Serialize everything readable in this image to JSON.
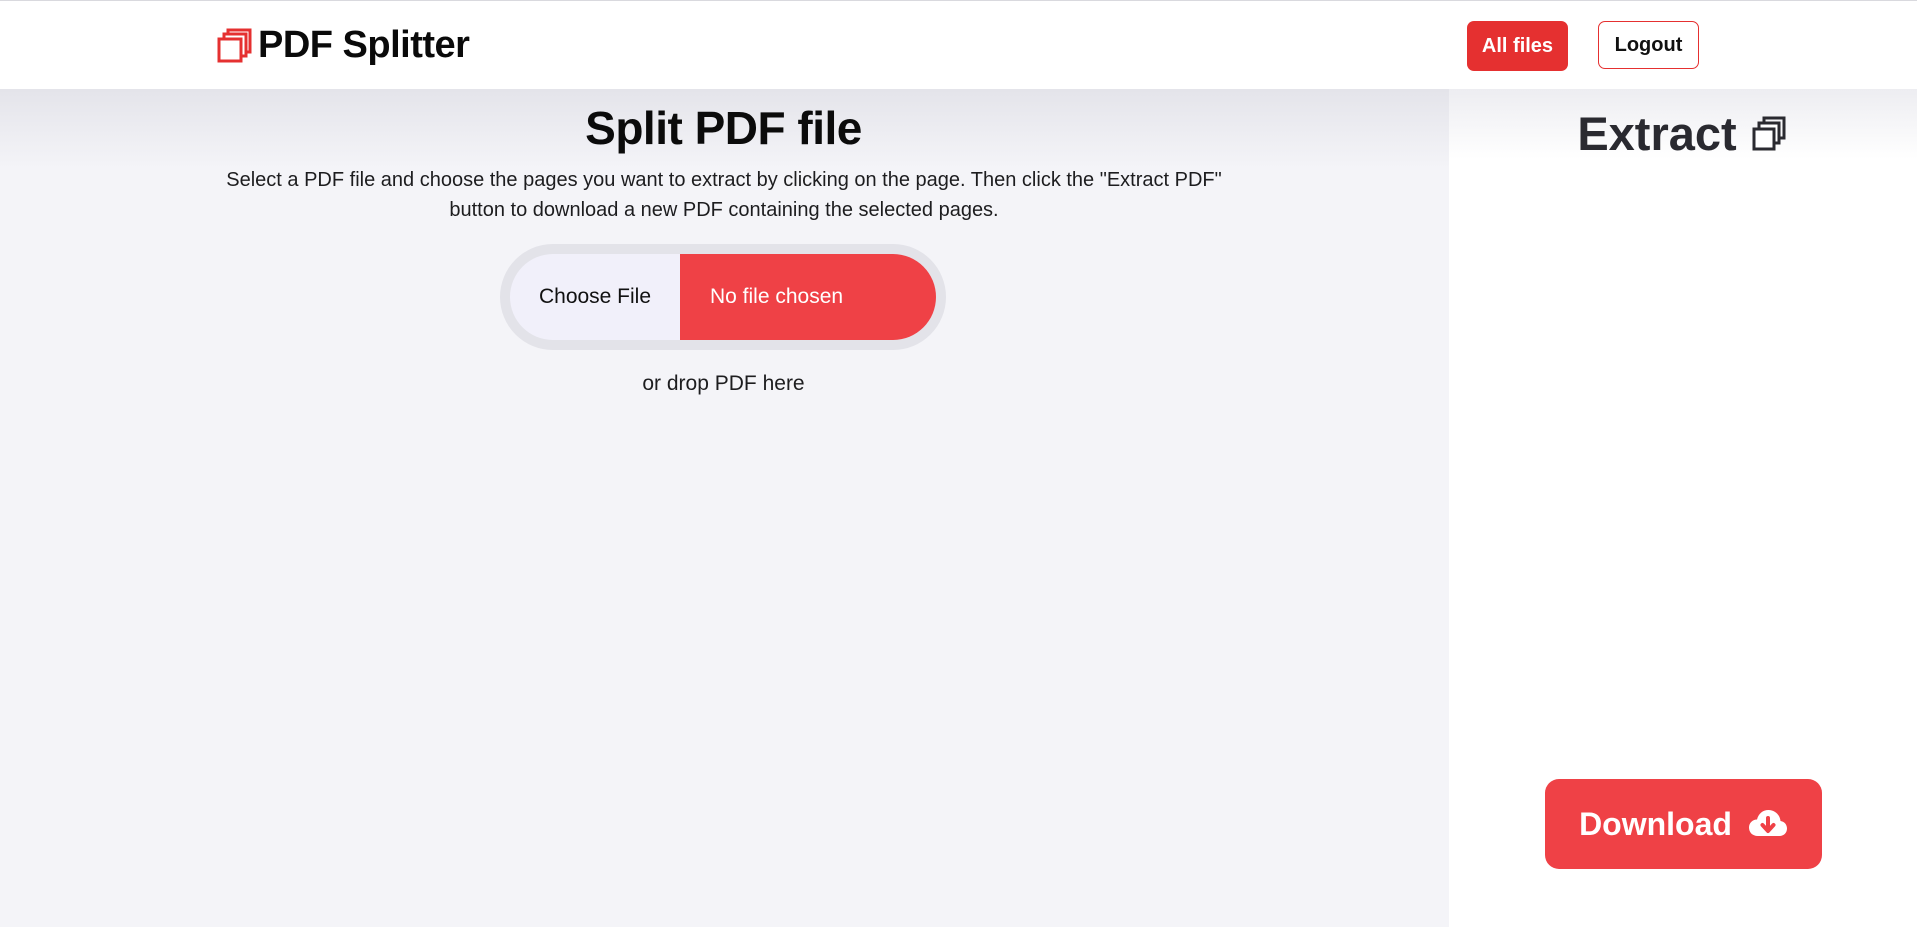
{
  "header": {
    "brand_name": "PDF Splitter",
    "brand_icon": "stacked-pages-icon",
    "all_files_label": "All files",
    "logout_label": "Logout"
  },
  "main": {
    "title": "Split PDF file",
    "description": "Select a PDF file and choose the pages you want to extract by clicking on the page. Then click the \"Extract PDF\" button to download a new PDF containing the selected pages.",
    "file_input": {
      "button_label": "Choose File",
      "status": "No file chosen"
    },
    "drop_hint": "or drop PDF here"
  },
  "sidebar": {
    "title": "Extract",
    "title_icon": "stacked-pages-icon",
    "download_label": "Download",
    "download_icon": "cloud-download-icon"
  },
  "colors": {
    "accent": "#ef4146",
    "accent_dark": "#e53030",
    "main_bg": "#f4f4f8",
    "sidebar_bg": "#ffffff",
    "pill_left_bg": "#f1f0fa"
  }
}
